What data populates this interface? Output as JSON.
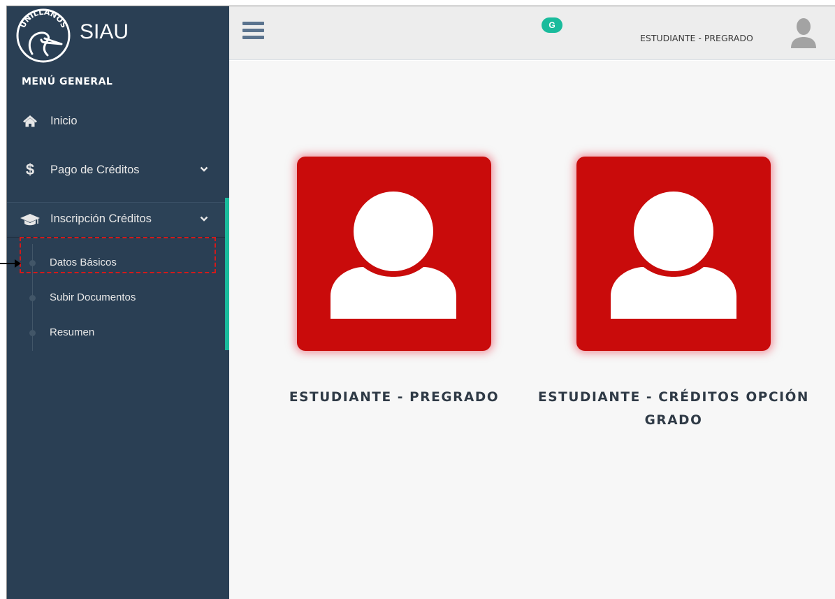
{
  "brand": {
    "title": "SIAU",
    "logo_text": "UNILLANOS"
  },
  "sidebar": {
    "heading": "MENÚ GENERAL",
    "items": [
      {
        "label": "Inicio",
        "icon": "home-icon"
      },
      {
        "label": "Pago de Créditos",
        "icon": "dollar-icon",
        "expandable": true
      },
      {
        "label": "Inscripción Créditos",
        "icon": "graduation-cap-icon",
        "expandable": true,
        "active": true
      }
    ],
    "subitems": [
      {
        "label": "Datos Básicos",
        "highlighted": true
      },
      {
        "label": "Subir Documentos"
      },
      {
        "label": "Resumen"
      }
    ]
  },
  "topnav": {
    "badge": "G",
    "role": "ESTUDIANTE - PREGRADO"
  },
  "cards": [
    {
      "label": "ESTUDIANTE - PREGRADO",
      "icon": "user-icon"
    },
    {
      "label": "ESTUDIANTE - CRÉDITOS OPCIÓN GRADO",
      "icon": "user-icon"
    }
  ],
  "colors": {
    "sidebar": "#2a3f54",
    "accent": "#1abb9c",
    "card": "#c90b0b",
    "highlight_box": "#d31a1a"
  }
}
